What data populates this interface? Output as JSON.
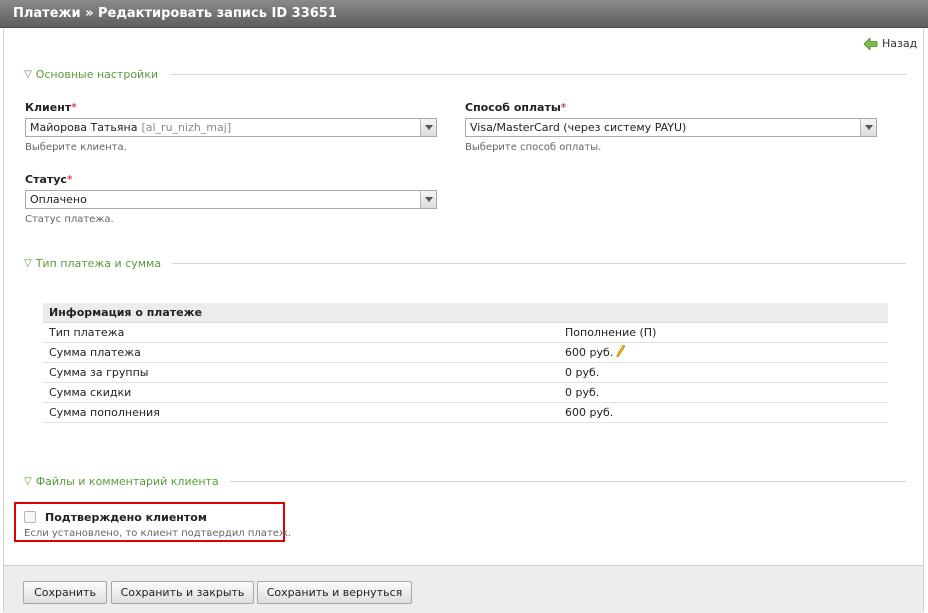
{
  "header": {
    "title": "Платежи » Редактировать запись ID 33651"
  },
  "nav": {
    "back_label": "Назад"
  },
  "sections": {
    "basic": "Основные настройки",
    "payment": "Тип платежа и сумма",
    "files": "Файлы и комментарий клиента"
  },
  "fields": {
    "client": {
      "label": "Клиент",
      "required_mark": "*",
      "value": "Майорова Татьяна",
      "login": "[al_ru_nizh_maj]",
      "hint": "Выберите клиента."
    },
    "payment_method": {
      "label": "Способ оплаты",
      "required_mark": "*",
      "value": "Visa/MasterCard (через систему PAYU)",
      "hint": "Выберите способ оплаты."
    },
    "status": {
      "label": "Статус",
      "required_mark": "*",
      "value": "Оплачено",
      "hint": "Статус платежа."
    }
  },
  "info": {
    "title": "Информация о платеже",
    "rows": [
      {
        "label": "Тип платежа",
        "value": "Пополнение (П)"
      },
      {
        "label": "Сумма платежа",
        "value": "600 руб."
      },
      {
        "label": "Сумма за группы",
        "value": "0 руб."
      },
      {
        "label": "Сумма скидки",
        "value": "0 руб."
      },
      {
        "label": "Сумма пополнения",
        "value": "600 руб."
      }
    ]
  },
  "confirm": {
    "label": "Подтверждено клиентом",
    "hint": "Если установлено, то клиент подтвердил платеж.",
    "checked": false
  },
  "footer": {
    "save": "Сохранить",
    "save_close": "Сохранить и закрыть",
    "save_return": "Сохранить и вернуться"
  },
  "colors": {
    "accent_green": "#5a9a3c",
    "highlight_red": "#e00000",
    "required_red": "#dd0000"
  },
  "icons": {
    "back": "back-arrow-icon",
    "edit": "pencil-icon",
    "section_toggle": "triangle-down-icon",
    "dropdown": "chevron-down-icon"
  }
}
